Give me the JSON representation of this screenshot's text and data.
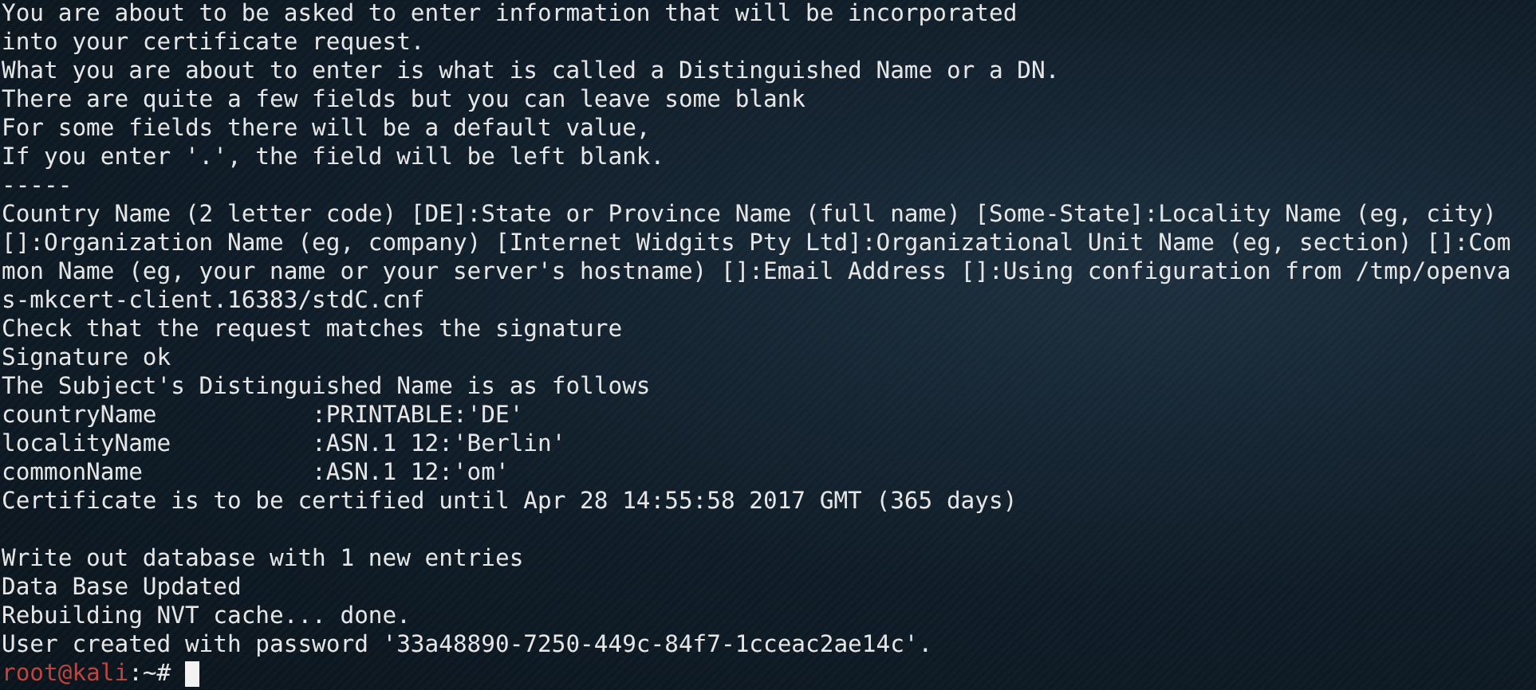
{
  "terminal": {
    "lines": [
      {
        "text": "You are about to be asked to enter information that will be incorporated"
      },
      {
        "text": "into your certificate request."
      },
      {
        "text": "What you are about to enter is what is called a Distinguished Name or a DN."
      },
      {
        "text": "There are quite a few fields but you can leave some blank"
      },
      {
        "text": "For some fields there will be a default value,"
      },
      {
        "text": "If you enter '.', the field will be left blank."
      },
      {
        "text": "-----"
      },
      {
        "text": "Country Name (2 letter code) [DE]:State or Province Name (full name) [Some-State]:Locality Name (eg, city)"
      },
      {
        "text": "[]:Organization Name (eg, company) [Internet Widgits Pty Ltd]:Organizational Unit Name (eg, section) []:Com"
      },
      {
        "text": "mon Name (eg, your name or your server's hostname) []:Email Address []:Using configuration from /tmp/openva"
      },
      {
        "text": "s-mkcert-client.16383/stdC.cnf"
      },
      {
        "text": "Check that the request matches the signature"
      },
      {
        "text": "Signature ok"
      },
      {
        "text": "The Subject's Distinguished Name is as follows"
      },
      {
        "text": "countryName           :PRINTABLE:'DE'"
      },
      {
        "text": "localityName          :ASN.1 12:'Berlin'"
      },
      {
        "text": "commonName            :ASN.1 12:'om'"
      },
      {
        "text": "Certificate is to be certified until Apr 28 14:55:58 2017 GMT (365 days)"
      },
      {
        "text": "Write out database with 1 new entries",
        "blank_before": true
      },
      {
        "text": "Data Base Updated"
      },
      {
        "text": "Rebuilding NVT cache... done."
      },
      {
        "text": "User created with password '33a48890-7250-449c-84f7-1cceac2ae14c'."
      }
    ],
    "prompt": {
      "user_host": "root@kali",
      "path": ":~# ",
      "cursor": true
    }
  }
}
